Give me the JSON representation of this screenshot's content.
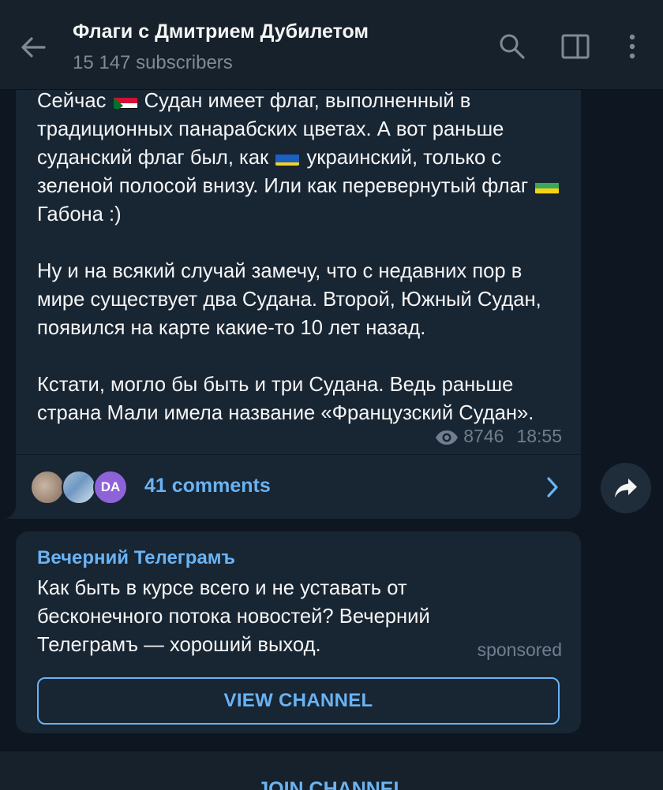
{
  "header": {
    "title": "Флаги с Дмитрием Дубилетом",
    "subtitle": "15 147 subscribers",
    "icons": [
      "back-arrow-icon",
      "search-icon",
      "side-panel-icon",
      "more-vertical-icon"
    ]
  },
  "post": {
    "paragraph1": {
      "p1": "Сейчас ",
      "flag1": "sudan-flag",
      "p2": " Судан имеет флаг, выполненный в традиционных панарабских цветах. А вот раньше суданский флаг был, как ",
      "flag2": "ukraine-flag",
      "p3": " украинский, только с зеленой полосой внизу. Или как перевернутый флаг ",
      "flag3": "gabon-flag",
      "p4": " Габона :)"
    },
    "paragraph2": "Ну и на всякий случай замечу, что с недавних пор в мире существует два Судана. Второй, Южный Судан, появился на карте какие-то 10 лет назад.",
    "paragraph3": "Кстати, могло бы быть и три Судана. Ведь раньше страна Мали имела название «Французский Судан».",
    "views": "8746",
    "time": "18:55",
    "comments": {
      "label": "41 comments",
      "avatar3_initials": "DA"
    }
  },
  "sponsored": {
    "channel": "Вечерний Телеграмъ",
    "text": "Как быть в курсе всего и не уставать от бесконечного потока новостей? Вечерний Телеграмъ — хороший выход.",
    "label": "sponsored",
    "button": "VIEW CHANNEL"
  },
  "bottom": {
    "join": "JOIN CHANNEL"
  },
  "colors": {
    "accent": "#6ab3f3",
    "background": "#0e1621",
    "bubble": "#182533",
    "header": "#17212b"
  }
}
